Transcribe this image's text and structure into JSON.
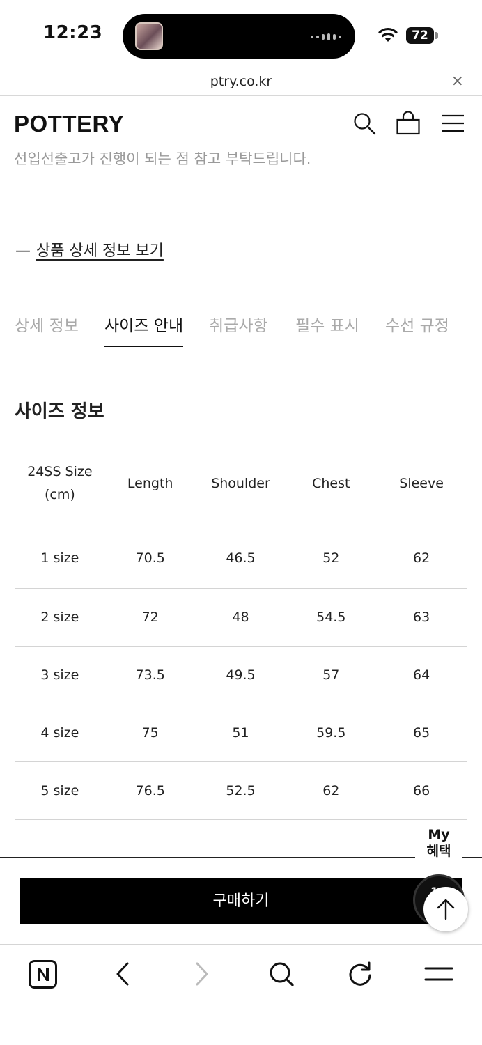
{
  "status_bar": {
    "time": "12:23",
    "battery": "72",
    "icons": [
      "wifi-icon",
      "battery-icon"
    ]
  },
  "browser": {
    "url": "ptry.co.kr",
    "close_label": "×"
  },
  "header": {
    "logo": "POTTERY",
    "icons": [
      "search-icon",
      "bag-icon",
      "menu-icon"
    ]
  },
  "content": {
    "notice": "선입선출고가 진행이 되는 점 참고 부탁드립니다.",
    "detail_dash": "—",
    "detail_link": "상품 상세 정보 보기",
    "tabs": [
      {
        "label": "상세 정보",
        "active": false
      },
      {
        "label": "사이즈 안내",
        "active": true
      },
      {
        "label": "취급사항",
        "active": false
      },
      {
        "label": "필수 표시",
        "active": false
      },
      {
        "label": "수선 규정",
        "active": false
      }
    ],
    "section_title": "사이즈 정보",
    "table": {
      "header_line1": "24SS Size",
      "header_line2": "(cm)",
      "headers": [
        "Length",
        "Shoulder",
        "Chest",
        "Sleeve"
      ],
      "rows": [
        [
          "1 size",
          "70.5",
          "46.5",
          "52",
          "62"
        ],
        [
          "2 size",
          "72",
          "48",
          "54.5",
          "63"
        ],
        [
          "3 size",
          "73.5",
          "49.5",
          "57",
          "64"
        ],
        [
          "4 size",
          "75",
          "51",
          "59.5",
          "65"
        ],
        [
          "5 size",
          "76.5",
          "52.5",
          "62",
          "66"
        ]
      ]
    }
  },
  "floating": {
    "my_line1": "My",
    "my_line2": "혜택",
    "dark_text": "1:1"
  },
  "buy_button": "구매하기",
  "browser_toolbar": [
    "naver-n-icon",
    "back-icon",
    "forward-icon",
    "search-icon",
    "refresh-icon",
    "menu-icon"
  ]
}
